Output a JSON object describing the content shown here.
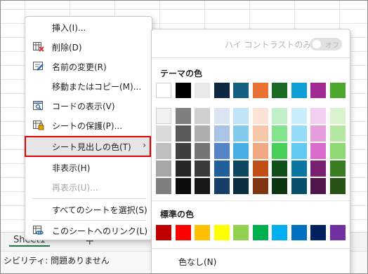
{
  "sheet": {
    "tab_label": "Sheet1",
    "add_label": "+"
  },
  "status": {
    "text": "シビリティ: 問題ありません"
  },
  "context_menu": {
    "items": [
      {
        "label": "挿入(I)...",
        "icon": "",
        "disabled": false
      },
      {
        "label": "削除(D)",
        "icon": "delete-sheet-icon",
        "disabled": false
      },
      {
        "label": "名前の変更(R)",
        "icon": "rename-icon",
        "disabled": false
      },
      {
        "label": "移動またはコピー(M)...",
        "icon": "",
        "disabled": false
      },
      {
        "label": "コードの表示(V)",
        "icon": "view-code-icon",
        "disabled": false
      },
      {
        "label": "シートの保護(P)...",
        "icon": "protect-sheet-icon",
        "disabled": false
      },
      {
        "label": "シート見出しの色(T)",
        "icon": "",
        "disabled": false,
        "submenu_arrow": "›"
      },
      {
        "label": "非表示(H)",
        "icon": "",
        "disabled": false
      },
      {
        "label": "再表示(U)...",
        "icon": "",
        "disabled": true
      },
      {
        "label": "すべてのシートを選択(S)",
        "icon": "",
        "disabled": false
      },
      {
        "label": "このシートへのリンク(L)",
        "icon": "link-sheet-icon",
        "disabled": false
      }
    ]
  },
  "color_menu": {
    "high_contrast_label": "ハイ コントラストのみ(H)",
    "toggle_label": "オフ",
    "theme_title": "テーマの色",
    "standard_title": "標準の色",
    "no_color_label": "色なし(N)",
    "theme_colors": [
      [
        "#ffffff",
        "#000000",
        "#e8e8e8",
        "#0e2841",
        "#156082",
        "#e97132",
        "#196b24",
        "#0f9ed5",
        "#a02b93",
        "#4ea72e"
      ],
      [
        "#f2f2f2",
        "#7f7f7f",
        "#d0d0d0",
        "#dbe5f1",
        "#c0e4f5",
        "#fbe2d5",
        "#c1f0c8",
        "#caeefb",
        "#f2cfee",
        "#daf2d0"
      ],
      [
        "#d9d9d9",
        "#595959",
        "#aeaeae",
        "#a9c4e4",
        "#83cbeb",
        "#f7c7ac",
        "#83e28e",
        "#95dcf8",
        "#e59edd",
        "#b5e6a2"
      ],
      [
        "#bfbfbf",
        "#404040",
        "#757575",
        "#5584c8",
        "#47afe4",
        "#f1a983",
        "#48d158",
        "#60caf3",
        "#d86dcd",
        "#8ed973"
      ],
      [
        "#a6a6a6",
        "#262626",
        "#3a3a3a",
        "#215f9a",
        "#0f4761",
        "#c04f15",
        "#134f1a",
        "#0b76a0",
        "#782170",
        "#3b7d23"
      ],
      [
        "#7f7f7f",
        "#0d0d0d",
        "#171717",
        "#153f66",
        "#0a2f41",
        "#803510",
        "#0d3512",
        "#074f6a",
        "#50164b",
        "#275317"
      ]
    ],
    "standard_colors": [
      "#c00000",
      "#ff0000",
      "#ffc000",
      "#ffff00",
      "#92d050",
      "#00b050",
      "#00b0f0",
      "#0070c0",
      "#002060",
      "#7030a0"
    ]
  }
}
